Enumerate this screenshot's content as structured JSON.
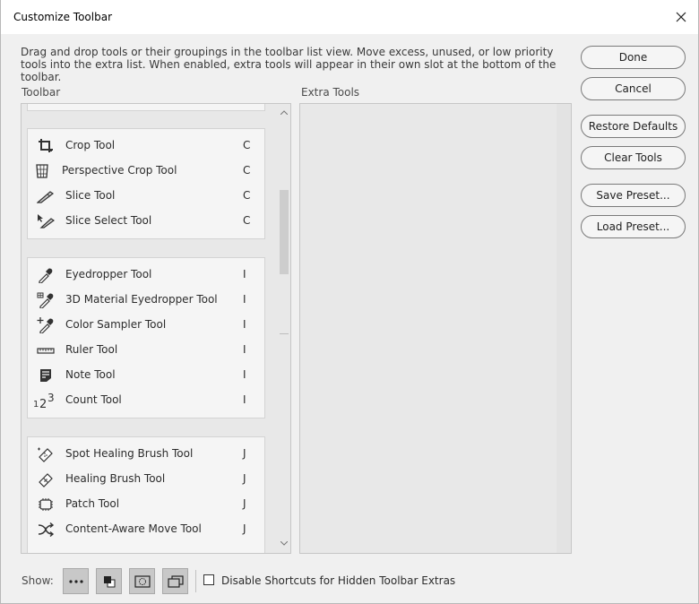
{
  "window": {
    "title": "Customize Toolbar"
  },
  "description": "Drag and drop tools or their groupings in the toolbar list view. Move excess, unused, or low priority tools into the extra list. When enabled, extra tools will appear in their own slot at the bottom of the toolbar.",
  "toolbar_label": "Toolbar",
  "extra_label": "Extra Tools",
  "groups": [
    {
      "tools": [
        {
          "name": "Crop Tool",
          "key": "C",
          "icon": "crop-icon"
        },
        {
          "name": "Perspective Crop Tool",
          "key": "C",
          "icon": "perspective-crop-icon"
        },
        {
          "name": "Slice Tool",
          "key": "C",
          "icon": "slice-icon"
        },
        {
          "name": "Slice Select Tool",
          "key": "C",
          "icon": "slice-select-icon"
        }
      ]
    },
    {
      "tools": [
        {
          "name": "Eyedropper Tool",
          "key": "I",
          "icon": "eyedropper-icon"
        },
        {
          "name": "3D Material Eyedropper Tool",
          "key": "I",
          "icon": "3d-material-eyedropper-icon"
        },
        {
          "name": "Color Sampler Tool",
          "key": "I",
          "icon": "color-sampler-icon"
        },
        {
          "name": "Ruler Tool",
          "key": "I",
          "icon": "ruler-icon"
        },
        {
          "name": "Note Tool",
          "key": "I",
          "icon": "note-icon"
        },
        {
          "name": "Count Tool",
          "key": "I",
          "icon": "count-icon"
        }
      ]
    },
    {
      "tools": [
        {
          "name": "Spot Healing Brush Tool",
          "key": "J",
          "icon": "spot-healing-icon"
        },
        {
          "name": "Healing Brush Tool",
          "key": "J",
          "icon": "healing-brush-icon"
        },
        {
          "name": "Patch Tool",
          "key": "J",
          "icon": "patch-icon"
        },
        {
          "name": "Content-Aware Move Tool",
          "key": "J",
          "icon": "content-aware-move-icon"
        }
      ]
    }
  ],
  "buttons": {
    "done": "Done",
    "cancel": "Cancel",
    "restore": "Restore Defaults",
    "clear": "Clear Tools",
    "save": "Save Preset...",
    "load": "Load Preset..."
  },
  "show_label": "Show:",
  "show_buttons": [
    "more-icon",
    "fg-bg-color-icon",
    "quick-mask-icon",
    "screen-mode-icon"
  ],
  "disable_shortcuts": {
    "label": "Disable Shortcuts for Hidden Toolbar Extras",
    "checked": false
  }
}
